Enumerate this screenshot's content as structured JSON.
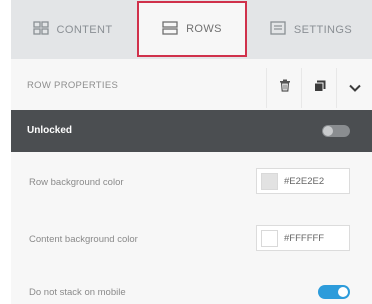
{
  "tabs": [
    {
      "label": "CONTENT",
      "icon": "grid-icon"
    },
    {
      "label": "ROWS",
      "icon": "rows-icon"
    },
    {
      "label": "SETTINGS",
      "icon": "settings-icon"
    }
  ],
  "row_properties": {
    "title": "ROW PROPERTIES",
    "actions": [
      "delete-icon",
      "duplicate-icon",
      "chevron-down-icon"
    ]
  },
  "lock": {
    "label": "Unlocked",
    "on": false
  },
  "fields": {
    "row_bg": {
      "label": "Row background color",
      "value": "#E2E2E2",
      "swatch": "#E2E2E2"
    },
    "content_bg": {
      "label": "Content background color",
      "value": "#FFFFFF",
      "swatch": "#FFFFFF"
    },
    "stack": {
      "label": "Do not stack on mobile",
      "on": true
    }
  },
  "colors": {
    "active_tab_border": "#d0314b",
    "toggle_on": "#2d9cdb",
    "dark_bar": "#4b4e51"
  }
}
